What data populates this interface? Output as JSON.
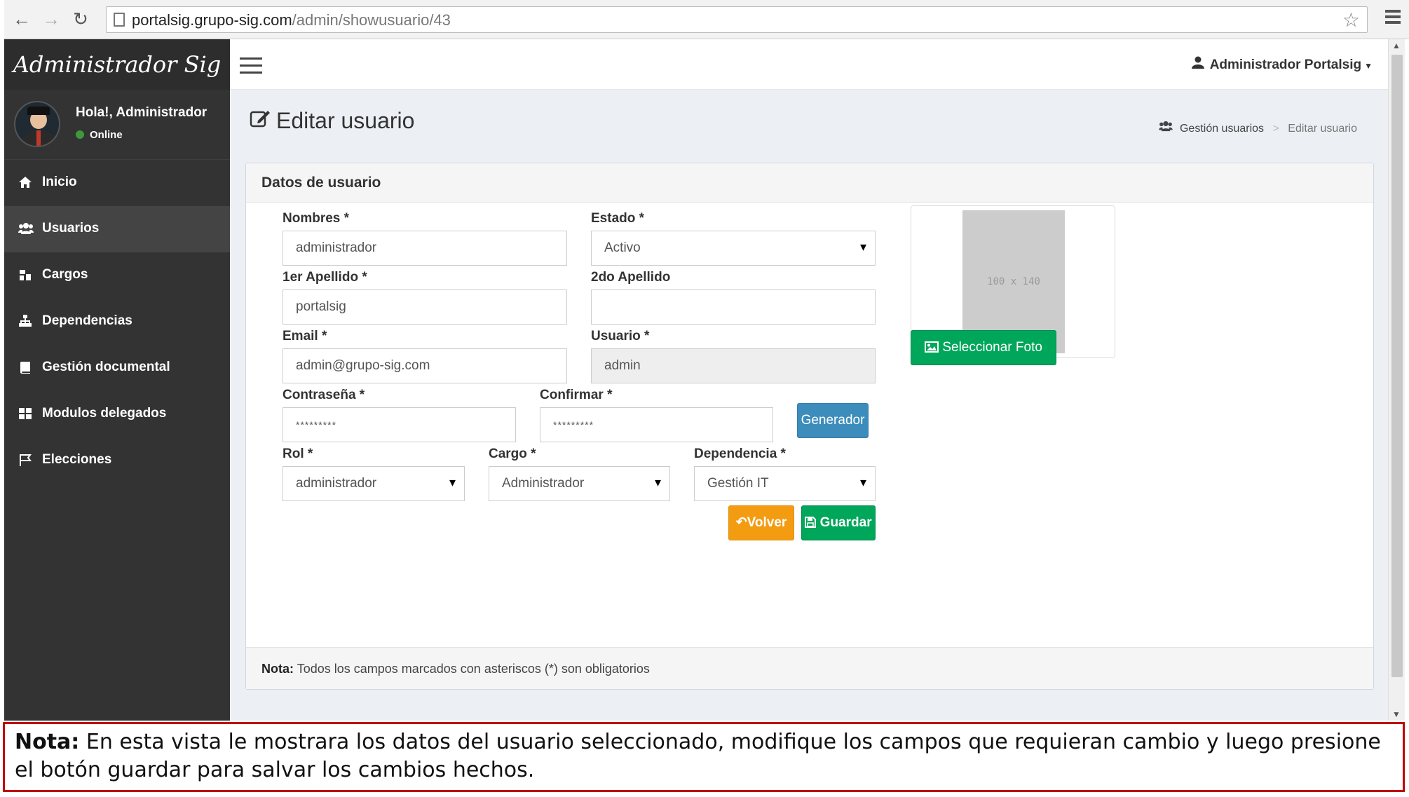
{
  "browser": {
    "url_host": "portalsig.grupo-sig.com",
    "url_path": "/admin/showusuario/43"
  },
  "sidebar": {
    "logo": "Administrador Sig",
    "greeting": "Hola!, Administrador",
    "status": "Online",
    "items": [
      {
        "label": "Inicio",
        "icon": "home-icon"
      },
      {
        "label": "Usuarios",
        "icon": "users-icon"
      },
      {
        "label": "Cargos",
        "icon": "sitemap-icon"
      },
      {
        "label": "Dependencias",
        "icon": "hierarchy-icon"
      },
      {
        "label": "Gestión documental",
        "icon": "book-icon"
      },
      {
        "label": "Modulos delegados",
        "icon": "grid-icon"
      },
      {
        "label": "Elecciones",
        "icon": "flag-icon"
      }
    ]
  },
  "header": {
    "user_label": "Administrador Portalsig"
  },
  "page": {
    "title": "Editar usuario",
    "breadcrumb": [
      "Gestión usuarios",
      "Editar usuario"
    ]
  },
  "form": {
    "box_title": "Datos de usuario",
    "nombres_label": "Nombres *",
    "nombres_value": "administrador",
    "estado_label": "Estado *",
    "estado_value": "Activo",
    "apellido1_label": "1er Apellido *",
    "apellido1_value": "portalsig",
    "apellido2_label": "2do Apellido",
    "apellido2_value": "",
    "email_label": "Email *",
    "email_value": "admin@grupo-sig.com",
    "usuario_label": "Usuario *",
    "usuario_value": "admin",
    "password_label": "Contraseña *",
    "password_value": "*********",
    "confirm_label": "Confirmar *",
    "confirm_value": "*********",
    "generator_button": "Generador",
    "rol_label": "Rol *",
    "rol_value": "administrador",
    "cargo_label": "Cargo *",
    "cargo_value": "Administrador",
    "dependencia_label": "Dependencia *",
    "dependencia_value": "Gestión IT",
    "photo_placeholder": "100 x 140",
    "select_photo_button": "Seleccionar Foto",
    "back_button": "Volver",
    "save_button": "Guardar",
    "footer_note_bold": "Nota:",
    "footer_note": "Todos los campos marcados con asteriscos (*) son obligatorios"
  },
  "bottom_note": {
    "bold": "Nota:",
    "text": "En esta vista le mostrara los datos del usuario seleccionado, modifique los campos que requieran cambio y luego presione el botón guardar para salvar los cambios hechos."
  }
}
